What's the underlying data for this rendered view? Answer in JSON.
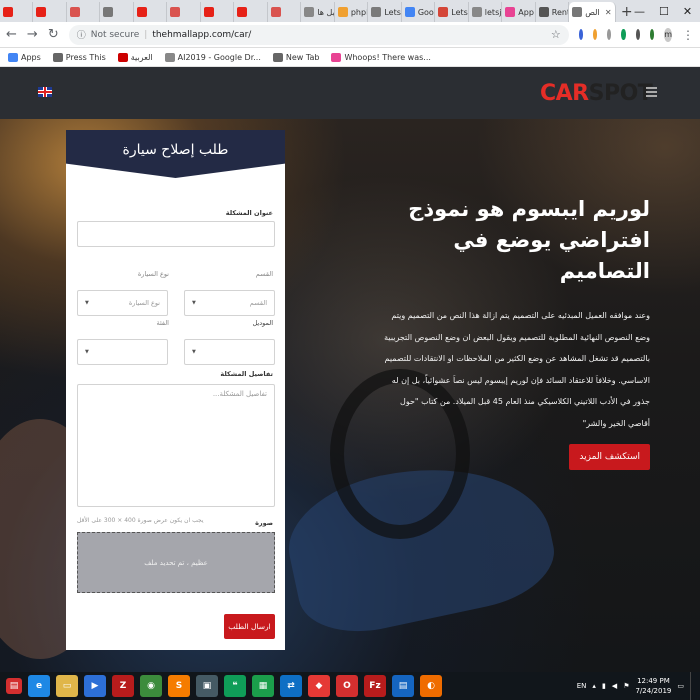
{
  "browser": {
    "tabs": [
      {
        "label": "",
        "favicon_color": "#e62117"
      },
      {
        "label": "",
        "favicon_color": "#e62117"
      },
      {
        "label": "",
        "favicon_color": "#d9534f"
      },
      {
        "label": "",
        "favicon_color": "#777777"
      },
      {
        "label": "",
        "favicon_color": "#e62117"
      },
      {
        "label": "",
        "favicon_color": "#d9534f"
      },
      {
        "label": "",
        "favicon_color": "#e62117"
      },
      {
        "label": "",
        "favicon_color": "#e62117"
      },
      {
        "label": "",
        "favicon_color": "#d9534f"
      },
      {
        "label": "تحليل ها",
        "favicon_color": "#888888"
      },
      {
        "label": "phpMy",
        "favicon_color": "#f0a030"
      },
      {
        "label": "LetsM",
        "favicon_color": "#7a7a7a"
      },
      {
        "label": "Googl",
        "favicon_color": "#4285f4"
      },
      {
        "label": "LetsM",
        "favicon_color": "#d44638"
      },
      {
        "label": "letsjo",
        "favicon_color": "#888888"
      },
      {
        "label": "App R",
        "favicon_color": "#e84393"
      },
      {
        "label": "Rent It",
        "favicon_color": "#555555"
      }
    ],
    "active_tab": {
      "label": "الص",
      "favicon_color": "#777777"
    },
    "url_info": "Not secure",
    "url": "thehmallapp.com/car/",
    "bookmarks": [
      {
        "label": "Apps",
        "color": "#4285f4"
      },
      {
        "label": "Press This",
        "color": "#666666"
      },
      {
        "label": "العربية",
        "color": "#cc0000"
      },
      {
        "label": "AI2019 - Google Dr...",
        "color": "#888888"
      },
      {
        "label": "New Tab",
        "color": "#666666"
      },
      {
        "label": "Whoops! There was...",
        "color": "#e84393"
      }
    ],
    "profile_initial": "m"
  },
  "site": {
    "logo_part1": "CAR",
    "logo_part2": "SPOT",
    "accent_color": "#e52d27"
  },
  "hero": {
    "title": "لوريم ايبسوم هو نموذج افتراضي يوضع في التصاميم",
    "paragraph": "وعند موافقه العميل المبدئيه على التصميم يتم ازالة هذا النص من التصميم ويتم وضع النصوص النهائية المطلوبة للتصميم ويقول البعض ان وضع النصوص التجريبية بالتصميم قد تشغل المشاهد عن وضع الكثير من الملاحظات او الانتقادات للتصميم الاساسي. وخلافاَ للاعتقاد السائد فإن لوريم إيبسوم ليس نصاَ عشوائياً، بل إن له جذور في الأدب اللاتيني الكلاسيكي منذ العام 45 قبل الميلاد. من كتاب \"حول أقاصي الخير والشر\"",
    "button": "استكشف المزيد"
  },
  "form": {
    "title": "طلب إصلاح سيارة",
    "issue_title_label": "عنوان المشكلة",
    "make_label": "القسم",
    "make_placeholder": "القسم",
    "car_type_label": "نوع السيارة",
    "car_type_placeholder": "نوع السيارة",
    "model_label": "الموديل",
    "category_label": "الفئة",
    "details_label": "تفاصيل المشكلة",
    "details_placeholder": "تفاصيل المشكلة...",
    "image_label": "صورة",
    "image_hint": "يجب ان يكون عرض صورة 400 × 300 على الأقل",
    "dropzone_text": "عظيم ، تم تحديد ملف",
    "submit": "ارسال الطلب"
  },
  "taskbar": {
    "apps": [
      {
        "name": "ie",
        "color": "#1e88e5",
        "glyph": "e"
      },
      {
        "name": "explorer",
        "color": "#e0b64a",
        "glyph": "▭"
      },
      {
        "name": "media",
        "color": "#2d6fd6",
        "glyph": "▶"
      },
      {
        "name": "zynga",
        "color": "#b71c1c",
        "glyph": "Z"
      },
      {
        "name": "chrome",
        "color": "#3c8c3c",
        "glyph": "◉"
      },
      {
        "name": "sublime",
        "color": "#f57c00",
        "glyph": "S"
      },
      {
        "name": "tool",
        "color": "#455a64",
        "glyph": "▣"
      },
      {
        "name": "hangouts",
        "color": "#0f9d58",
        "glyph": "❝"
      },
      {
        "name": "sheets",
        "color": "#1b9e4b",
        "glyph": "▦"
      },
      {
        "name": "teamviewer",
        "color": "#0e6fc4",
        "glyph": "⇄"
      },
      {
        "name": "anydesk",
        "color": "#e53935",
        "glyph": "◆"
      },
      {
        "name": "opera",
        "color": "#d32f2f",
        "glyph": "O"
      },
      {
        "name": "filezilla",
        "color": "#b71c1c",
        "glyph": "Fz"
      },
      {
        "name": "phpstorm",
        "color": "#1565c0",
        "glyph": "▤"
      },
      {
        "name": "blender",
        "color": "#ef6c00",
        "glyph": "◐"
      }
    ],
    "lang": "EN",
    "time": "12:49 PM",
    "date": "7/24/2019"
  }
}
